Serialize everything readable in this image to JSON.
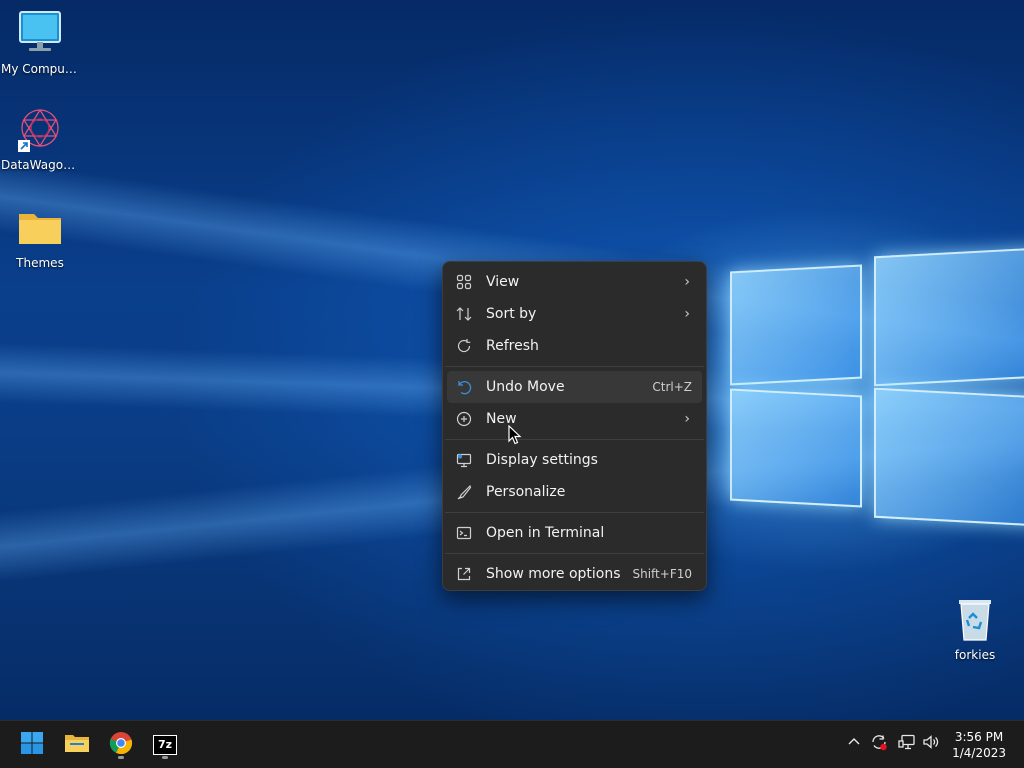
{
  "desktop": {
    "icons": [
      {
        "label": "My Computer",
        "icon": "monitor-icon"
      },
      {
        "label": "DataWagon...",
        "icon": "datawagon-app-icon"
      },
      {
        "label": "Themes",
        "icon": "folder-icon"
      },
      {
        "label": "forkies",
        "icon": "recycle-bin-icon"
      }
    ]
  },
  "context_menu": {
    "items": [
      {
        "label": "View",
        "icon": "grid-view-icon",
        "submenu": true
      },
      {
        "label": "Sort by",
        "icon": "sort-icon",
        "submenu": true
      },
      {
        "label": "Refresh",
        "icon": "refresh-icon"
      },
      {
        "label": "Undo Move",
        "icon": "undo-icon",
        "shortcut": "Ctrl+Z"
      },
      {
        "label": "New",
        "icon": "new-plus-icon",
        "submenu": true
      },
      {
        "label": "Display settings",
        "icon": "display-settings-icon"
      },
      {
        "label": "Personalize",
        "icon": "brush-icon"
      },
      {
        "label": "Open in Terminal",
        "icon": "terminal-icon"
      },
      {
        "label": "Show more options",
        "icon": "share-icon",
        "shortcut": "Shift+F10"
      }
    ]
  },
  "taskbar": {
    "apps": [
      {
        "name": "Start",
        "icon": "windows-start-icon"
      },
      {
        "name": "File Explorer",
        "icon": "file-explorer-icon"
      },
      {
        "name": "Google Chrome",
        "icon": "chrome-icon"
      },
      {
        "name": "7-Zip",
        "icon": "seven-zip-icon",
        "glyph": "7z"
      }
    ],
    "tray": {
      "chevron": "^",
      "time": "3:56 PM",
      "date": "1/4/2023"
    }
  },
  "colors": {
    "menu_bg": "#2b2b2b",
    "taskbar_bg": "#1c1c1c",
    "desktop_blue": "#0a3f8c"
  }
}
